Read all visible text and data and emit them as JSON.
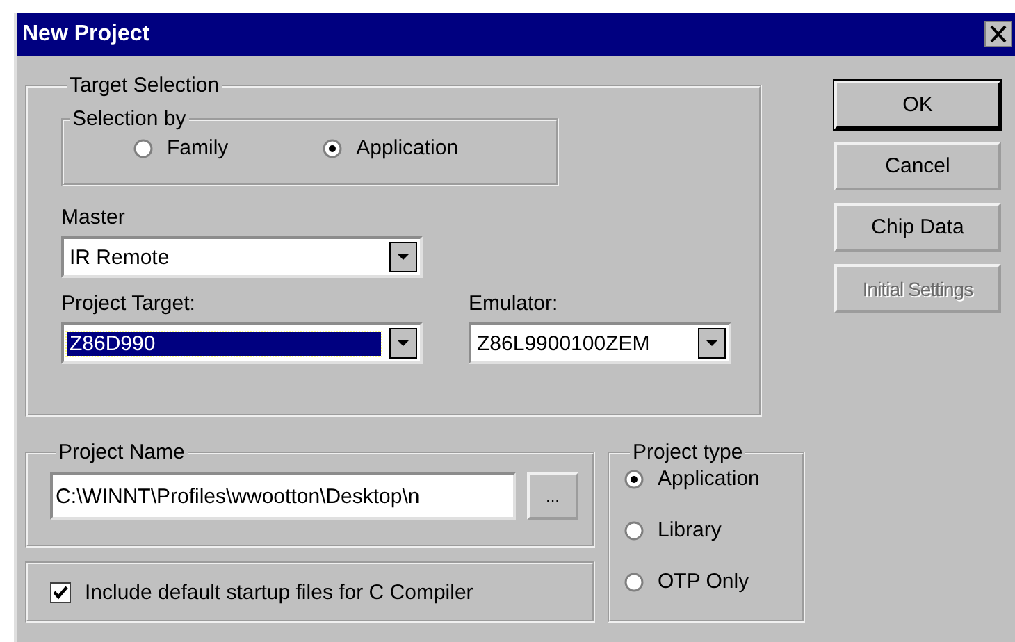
{
  "window": {
    "title": "New Project"
  },
  "target_selection": {
    "title": "Target Selection",
    "selection_by": {
      "title": "Selection by",
      "options": [
        {
          "label": "Family",
          "selected": false
        },
        {
          "label": "Application",
          "selected": true
        }
      ]
    },
    "master": {
      "label": "Master",
      "value": "IR Remote",
      "focused": false
    },
    "project_target": {
      "label": "Project Target:",
      "value": "Z86D990",
      "focused": true
    },
    "emulator": {
      "label": "Emulator:",
      "value": "Z86L9900100ZEM",
      "focused": false
    }
  },
  "project_name": {
    "title": "Project Name",
    "value": "C:\\WINNT\\Profiles\\wwootton\\Desktop\\n",
    "browse": "..."
  },
  "startup_files": {
    "label": "Include default startup files for C Compiler",
    "checked": true
  },
  "project_type": {
    "title": "Project type",
    "options": [
      {
        "label": "Application",
        "selected": true
      },
      {
        "label": "Library",
        "selected": false
      },
      {
        "label": "OTP Only",
        "selected": false
      }
    ]
  },
  "buttons": [
    {
      "label": "OK",
      "default": true,
      "disabled": false
    },
    {
      "label": "Cancel",
      "default": false,
      "disabled": false
    },
    {
      "label": "Chip Data",
      "default": false,
      "disabled": false
    },
    {
      "label": "Initial Settings",
      "default": false,
      "disabled": true
    }
  ]
}
